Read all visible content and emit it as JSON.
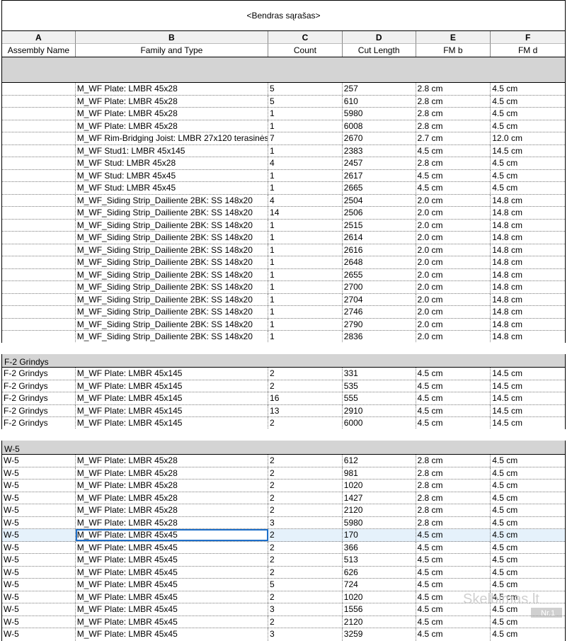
{
  "schedule": {
    "title": "<Bendras sąrašas>",
    "column_letters": [
      "A",
      "B",
      "C",
      "D",
      "E",
      "F"
    ],
    "column_names": [
      "Assembly Name",
      "Family and Type",
      "Count",
      "Cut Length",
      "FM b",
      "FM d"
    ]
  },
  "groups": [
    {
      "label": "",
      "rows": [
        [
          "",
          "M_WF Plate: LMBR 45x28",
          "5",
          "257",
          "2.8 cm",
          "4.5 cm"
        ],
        [
          "",
          "M_WF Plate: LMBR 45x28",
          "5",
          "610",
          "2.8 cm",
          "4.5 cm"
        ],
        [
          "",
          "M_WF Plate: LMBR 45x28",
          "1",
          "5980",
          "2.8 cm",
          "4.5 cm"
        ],
        [
          "",
          "M_WF Plate: LMBR 45x28",
          "1",
          "6008",
          "2.8 cm",
          "4.5 cm"
        ],
        [
          "",
          "M_WF Rim-Bridging Joist: LMBR 27x120 terasinės",
          "7",
          "2670",
          "2.7 cm",
          "12.0 cm"
        ],
        [
          "",
          "M_WF Stud1: LMBR 45x145",
          "1",
          "2383",
          "4.5 cm",
          "14.5 cm"
        ],
        [
          "",
          "M_WF Stud: LMBR 45x28",
          "4",
          "2457",
          "2.8 cm",
          "4.5 cm"
        ],
        [
          "",
          "M_WF Stud: LMBR 45x45",
          "1",
          "2617",
          "4.5 cm",
          "4.5 cm"
        ],
        [
          "",
          "M_WF Stud: LMBR 45x45",
          "1",
          "2665",
          "4.5 cm",
          "4.5 cm"
        ],
        [
          "",
          "M_WF_Siding Strip_Dailiente 2BK: SS 148x20",
          "4",
          "2504",
          "2.0 cm",
          "14.8 cm"
        ],
        [
          "",
          "M_WF_Siding Strip_Dailiente 2BK: SS 148x20",
          "14",
          "2506",
          "2.0 cm",
          "14.8 cm"
        ],
        [
          "",
          "M_WF_Siding Strip_Dailiente 2BK: SS 148x20",
          "1",
          "2515",
          "2.0 cm",
          "14.8 cm"
        ],
        [
          "",
          "M_WF_Siding Strip_Dailiente 2BK: SS 148x20",
          "1",
          "2614",
          "2.0 cm",
          "14.8 cm"
        ],
        [
          "",
          "M_WF_Siding Strip_Dailiente 2BK: SS 148x20",
          "1",
          "2616",
          "2.0 cm",
          "14.8 cm"
        ],
        [
          "",
          "M_WF_Siding Strip_Dailiente 2BK: SS 148x20",
          "1",
          "2648",
          "2.0 cm",
          "14.8 cm"
        ],
        [
          "",
          "M_WF_Siding Strip_Dailiente 2BK: SS 148x20",
          "1",
          "2655",
          "2.0 cm",
          "14.8 cm"
        ],
        [
          "",
          "M_WF_Siding Strip_Dailiente 2BK: SS 148x20",
          "1",
          "2700",
          "2.0 cm",
          "14.8 cm"
        ],
        [
          "",
          "M_WF_Siding Strip_Dailiente 2BK: SS 148x20",
          "1",
          "2704",
          "2.0 cm",
          "14.8 cm"
        ],
        [
          "",
          "M_WF_Siding Strip_Dailiente 2BK: SS 148x20",
          "1",
          "2746",
          "2.0 cm",
          "14.8 cm"
        ],
        [
          "",
          "M_WF_Siding Strip_Dailiente 2BK: SS 148x20",
          "1",
          "2790",
          "2.0 cm",
          "14.8 cm"
        ],
        [
          "",
          "M_WF_Siding Strip_Dailiente 2BK: SS 148x20",
          "1",
          "2836",
          "2.0 cm",
          "14.8 cm"
        ]
      ]
    },
    {
      "label": "F-2 Grindys",
      "rows": [
        [
          "F-2 Grindys",
          "M_WF Plate: LMBR 45x145",
          "2",
          "331",
          "4.5 cm",
          "14.5 cm"
        ],
        [
          "F-2 Grindys",
          "M_WF Plate: LMBR 45x145",
          "2",
          "535",
          "4.5 cm",
          "14.5 cm"
        ],
        [
          "F-2 Grindys",
          "M_WF Plate: LMBR 45x145",
          "16",
          "555",
          "4.5 cm",
          "14.5 cm"
        ],
        [
          "F-2 Grindys",
          "M_WF Plate: LMBR 45x145",
          "13",
          "2910",
          "4.5 cm",
          "14.5 cm"
        ],
        [
          "F-2 Grindys",
          "M_WF Plate: LMBR 45x145",
          "2",
          "6000",
          "4.5 cm",
          "14.5 cm"
        ]
      ]
    },
    {
      "label": "W-5",
      "selected_row": 6,
      "rows": [
        [
          "W-5",
          "M_WF Plate: LMBR 45x28",
          "2",
          "612",
          "2.8 cm",
          "4.5 cm"
        ],
        [
          "W-5",
          "M_WF Plate: LMBR 45x28",
          "2",
          "981",
          "2.8 cm",
          "4.5 cm"
        ],
        [
          "W-5",
          "M_WF Plate: LMBR 45x28",
          "2",
          "1020",
          "2.8 cm",
          "4.5 cm"
        ],
        [
          "W-5",
          "M_WF Plate: LMBR 45x28",
          "2",
          "1427",
          "2.8 cm",
          "4.5 cm"
        ],
        [
          "W-5",
          "M_WF Plate: LMBR 45x28",
          "2",
          "2120",
          "2.8 cm",
          "4.5 cm"
        ],
        [
          "W-5",
          "M_WF Plate: LMBR 45x28",
          "3",
          "5980",
          "2.8 cm",
          "4.5 cm"
        ],
        [
          "W-5",
          "M_WF Plate: LMBR 45x45",
          "2",
          "170",
          "4.5 cm",
          "4.5 cm"
        ],
        [
          "W-5",
          "M_WF Plate: LMBR 45x45",
          "2",
          "366",
          "4.5 cm",
          "4.5 cm"
        ],
        [
          "W-5",
          "M_WF Plate: LMBR 45x45",
          "2",
          "513",
          "4.5 cm",
          "4.5 cm"
        ],
        [
          "W-5",
          "M_WF Plate: LMBR 45x45",
          "2",
          "626",
          "4.5 cm",
          "4.5 cm"
        ],
        [
          "W-5",
          "M_WF Plate: LMBR 45x45",
          "5",
          "724",
          "4.5 cm",
          "4.5 cm"
        ],
        [
          "W-5",
          "M_WF Plate: LMBR 45x45",
          "2",
          "1020",
          "4.5 cm",
          "4.5 cm"
        ],
        [
          "W-5",
          "M_WF Plate: LMBR 45x45",
          "3",
          "1556",
          "4.5 cm",
          "4.5 cm"
        ],
        [
          "W-5",
          "M_WF Plate: LMBR 45x45",
          "2",
          "2120",
          "4.5 cm",
          "4.5 cm"
        ],
        [
          "W-5",
          "M_WF Plate: LMBR 45x45",
          "3",
          "3259",
          "4.5 cm",
          "4.5 cm"
        ]
      ]
    }
  ],
  "watermark": {
    "text": "Skelbimas.lt",
    "subtext": "Nr.1",
    "color": "#bdbdbd"
  }
}
